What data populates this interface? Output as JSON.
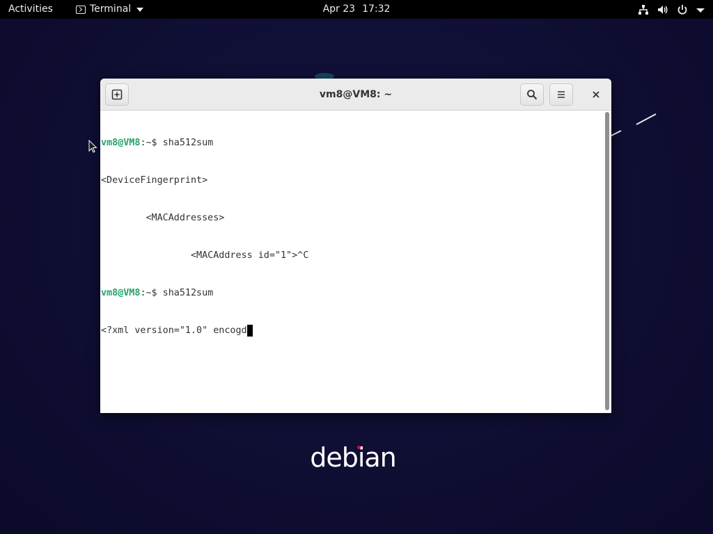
{
  "topbar": {
    "activities_label": "Activities",
    "app_name": "Terminal",
    "date": "Apr 23",
    "time": "17:32",
    "status_icons": [
      "network-icon",
      "volume-icon",
      "power-icon",
      "chevron-down-icon"
    ]
  },
  "terminal": {
    "title": "vm8@VM8: ~",
    "lines": [
      {
        "user": "vm8@VM8",
        "rest": ":~$ sha512sum"
      },
      {
        "text": "<DeviceFingerprint>"
      },
      {
        "text": "        <MACAddresses>"
      },
      {
        "text": "                <MACAddress id=\"1\">^C"
      },
      {
        "user": "vm8@VM8",
        "rest": ":~$ sha512sum"
      },
      {
        "text": "<?xml version=\"1.0\" encogd"
      }
    ],
    "header_icons": [
      "new-tab-icon",
      "search-icon",
      "hamburger-menu-icon",
      "close-icon"
    ]
  },
  "desktop": {
    "logo_text": "debian"
  },
  "colors": {
    "desktop_bg": "#0f0e33",
    "topbar_bg": "#000000",
    "prompt_user": "#26a269",
    "debian_dot": "#d70751"
  }
}
